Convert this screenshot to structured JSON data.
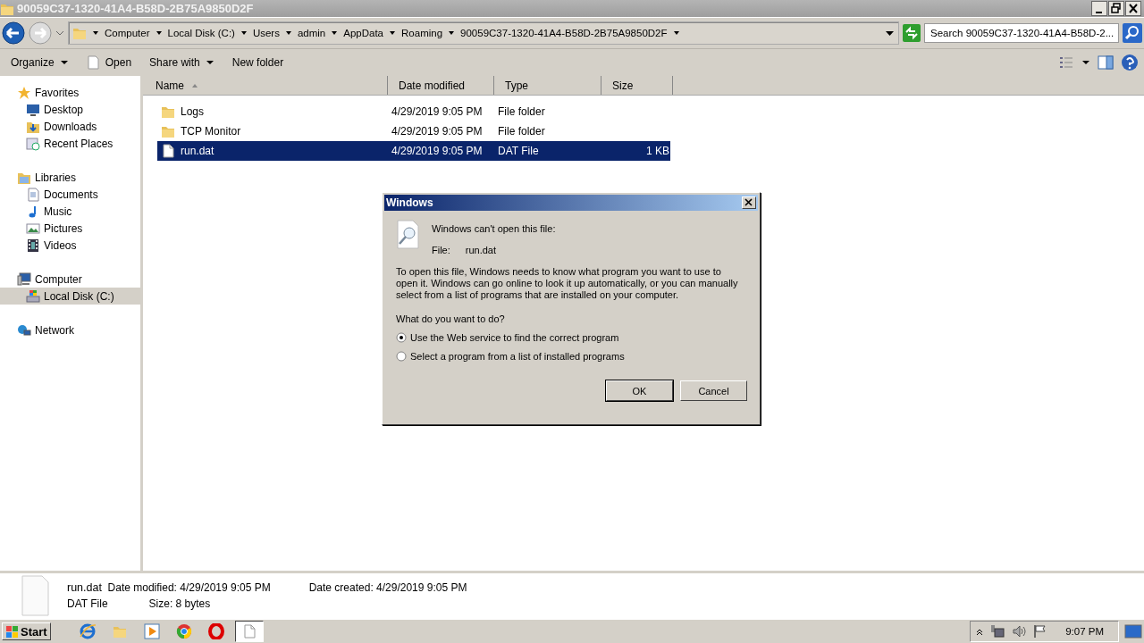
{
  "window": {
    "title": "90059C37-1320-41A4-B58D-2B75A9850D2F"
  },
  "address": {
    "crumbs": [
      "Computer",
      "Local Disk (C:)",
      "Users",
      "admin",
      "AppData",
      "Roaming",
      "90059C37-1320-41A4-B58D-2B75A9850D2F"
    ]
  },
  "search": {
    "placeholder": "Search 90059C37-1320-41A4-B58D-2..."
  },
  "toolbar": {
    "buttons": [
      {
        "label": "Organize",
        "kind": "menu"
      },
      {
        "label": "Open",
        "kind": "open"
      },
      {
        "label": "Share with",
        "kind": "menu"
      },
      {
        "label": "New folder",
        "kind": "plain"
      }
    ]
  },
  "sidebar": {
    "groups": [
      {
        "label": "Favorites",
        "kind": "star",
        "children": [
          {
            "label": "Desktop",
            "kind": "desktop",
            "selected": false
          },
          {
            "label": "Downloads",
            "kind": "download",
            "selected": false
          },
          {
            "label": "Recent Places",
            "kind": "recent",
            "selected": false
          }
        ]
      },
      {
        "label": "Libraries",
        "kind": "library",
        "children": [
          {
            "label": "Documents",
            "kind": "document",
            "selected": false
          },
          {
            "label": "Music",
            "kind": "music",
            "selected": false
          },
          {
            "label": "Pictures",
            "kind": "picture",
            "selected": false
          },
          {
            "label": "Videos",
            "kind": "video",
            "selected": false
          }
        ]
      },
      {
        "label": "Computer",
        "kind": "computer",
        "children": [
          {
            "label": "Local Disk (C:)",
            "kind": "disk",
            "selected": true
          }
        ]
      },
      {
        "label": "Network",
        "kind": "network"
      }
    ]
  },
  "table": {
    "columns": [
      {
        "label": "Name",
        "sorted": true
      },
      {
        "label": "Date modified",
        "sorted": false
      },
      {
        "label": "Type",
        "sorted": false
      },
      {
        "label": "Size",
        "sorted": false
      }
    ],
    "rows": [
      {
        "kind": "folder",
        "name": "Logs",
        "date": "4/29/2019 9:05 PM",
        "type": "File folder",
        "selected": false
      },
      {
        "kind": "folder",
        "name": "TCP Monitor",
        "date": "4/29/2019 9:05 PM",
        "type": "File folder",
        "selected": false
      },
      {
        "kind": "file",
        "name": "run.dat",
        "date": "4/29/2019 9:05 PM",
        "type": "DAT File",
        "size": "1 KB",
        "selected": true
      }
    ]
  },
  "details": {
    "name": "run.dat",
    "type": "DAT File",
    "fields": [
      {
        "label": "Date modified:",
        "value": "4/29/2019 9:05 PM"
      },
      {
        "label": "Date created:",
        "value": "4/29/2019 9:05 PM"
      },
      {
        "label": "Size:",
        "value": "8 bytes"
      }
    ]
  },
  "dialog": {
    "title": "Windows",
    "heading": "Windows can't open this file:",
    "file_label": "File:",
    "file_name": "run.dat",
    "message": "To open this file, Windows needs to know what program you want to use to open it. Windows can go online to look it up automatically, or you can manually select from a list of programs that are installed on your computer.",
    "question": "What do you want to do?",
    "options": [
      {
        "label": "Use the Web service to find the correct program",
        "selected": true
      },
      {
        "label": "Select a program from a list of installed programs",
        "selected": false
      }
    ],
    "buttons": [
      {
        "label": "OK",
        "default": true
      },
      {
        "label": "Cancel",
        "default": false
      }
    ]
  },
  "taskbar": {
    "start": "Start",
    "items": [
      {
        "kind": "ie",
        "active": false
      },
      {
        "kind": "explorer",
        "active": false
      },
      {
        "kind": "media",
        "active": false
      },
      {
        "kind": "chrome",
        "active": false
      },
      {
        "kind": "opera",
        "active": false
      },
      {
        "kind": "document",
        "active": true
      }
    ],
    "clock": "9:07 PM"
  }
}
